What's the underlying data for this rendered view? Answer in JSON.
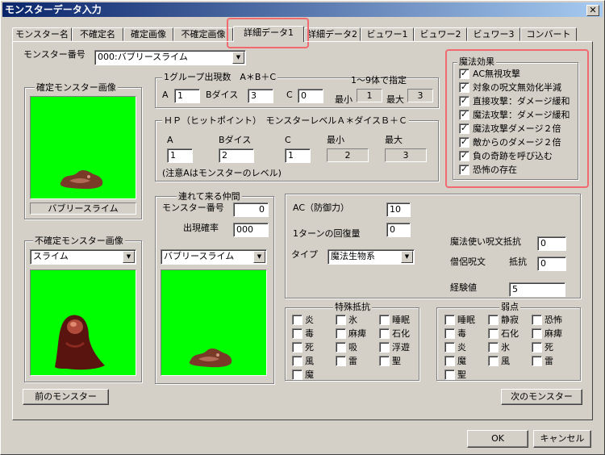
{
  "window": {
    "title": "モンスターデータ入力",
    "close_glyph": "✕"
  },
  "tabs": [
    "モンスター名",
    "不確定名",
    "確定画像",
    "不確定画像",
    "詳細データ1",
    "詳細データ2",
    "ビュワー1",
    "ビュワー2",
    "ビュワー3",
    "コンバート"
  ],
  "monster_no": {
    "label": "モンスター番号",
    "value": "000:バブリースライム"
  },
  "confirmed_image": {
    "title": "確定モンスター画像",
    "caption": "バブリースライム"
  },
  "uncertain_image": {
    "title": "不確定モンスター画像",
    "select": "スライム"
  },
  "group_count": {
    "title": "1グループ出現数　A＊B＋C",
    "hint": "1～9体で指定",
    "a_label": "A",
    "a_value": "1",
    "b_label": "Bダイス",
    "b_value": "3",
    "c_label": "C",
    "c_value": "0",
    "min_label": "最小",
    "min_value": "1",
    "max_label": "最大",
    "max_value": "3"
  },
  "hp": {
    "title": "ＨＰ（ヒットポイント）　モンスターレベルＡ＊ダイスＢ＋Ｃ",
    "a_label": "A",
    "a_value": "1",
    "b_label": "Bダイス",
    "b_value": "2",
    "c_label": "C",
    "c_value": "1",
    "min_label": "最小",
    "min_value": "2",
    "max_label": "最大",
    "max_value": "3",
    "note": "(注意Aはモンスターのレベル)"
  },
  "companion": {
    "title": "連れて来る仲間",
    "no_label": "モンスター番号",
    "no_value": "0",
    "rate_label": "出現確率",
    "rate_value": "000",
    "select": "バブリースライム"
  },
  "stats": {
    "ac_label": "AC（防御力）",
    "ac_value": "10",
    "regen_label": "1ターンの回復量",
    "regen_value": "0",
    "type_label": "タイプ",
    "type_value": "魔法生物系",
    "mage_resist_label": "魔法使い呪文抵抗",
    "mage_resist_value": "0",
    "priest_label": "僧侶呪文",
    "priest_resist_label": "抵抗",
    "priest_resist_value": "0",
    "exp_label": "経験値",
    "exp_value": "5"
  },
  "magic_effects": {
    "title": "魔法効果",
    "items": [
      {
        "label": "AC無視攻撃",
        "checked": true
      },
      {
        "label": "対象の呪文無効化半減",
        "checked": true
      },
      {
        "label": "直接攻撃：ダメージ緩和",
        "checked": true
      },
      {
        "label": "魔法攻撃：ダメージ緩和",
        "checked": true
      },
      {
        "label": "魔法攻撃ダメージ２倍",
        "checked": true
      },
      {
        "label": "敵からのダメージ２倍",
        "checked": true
      },
      {
        "label": "負の奇跡を呼び込む",
        "checked": true
      },
      {
        "label": "恐怖の存在",
        "checked": true
      }
    ]
  },
  "resistances": {
    "title": "特殊抵抗",
    "items": [
      "炎",
      "氷",
      "睡眠",
      "毒",
      "麻痺",
      "石化",
      "死",
      "吸",
      "浮遊",
      "風",
      "雷",
      "聖",
      "魔"
    ]
  },
  "weaknesses": {
    "title": "弱点",
    "items": [
      "睡眠",
      "静寂",
      "恐怖",
      "毒",
      "石化",
      "麻痺",
      "炎",
      "氷",
      "死",
      "魔",
      "風",
      "雷",
      "聖"
    ]
  },
  "buttons": {
    "prev": "前のモンスター",
    "next": "次のモンスター",
    "ok": "OK",
    "cancel": "キャンセル"
  },
  "accent_color": "#f06a70",
  "image_bg": "#00ff00"
}
